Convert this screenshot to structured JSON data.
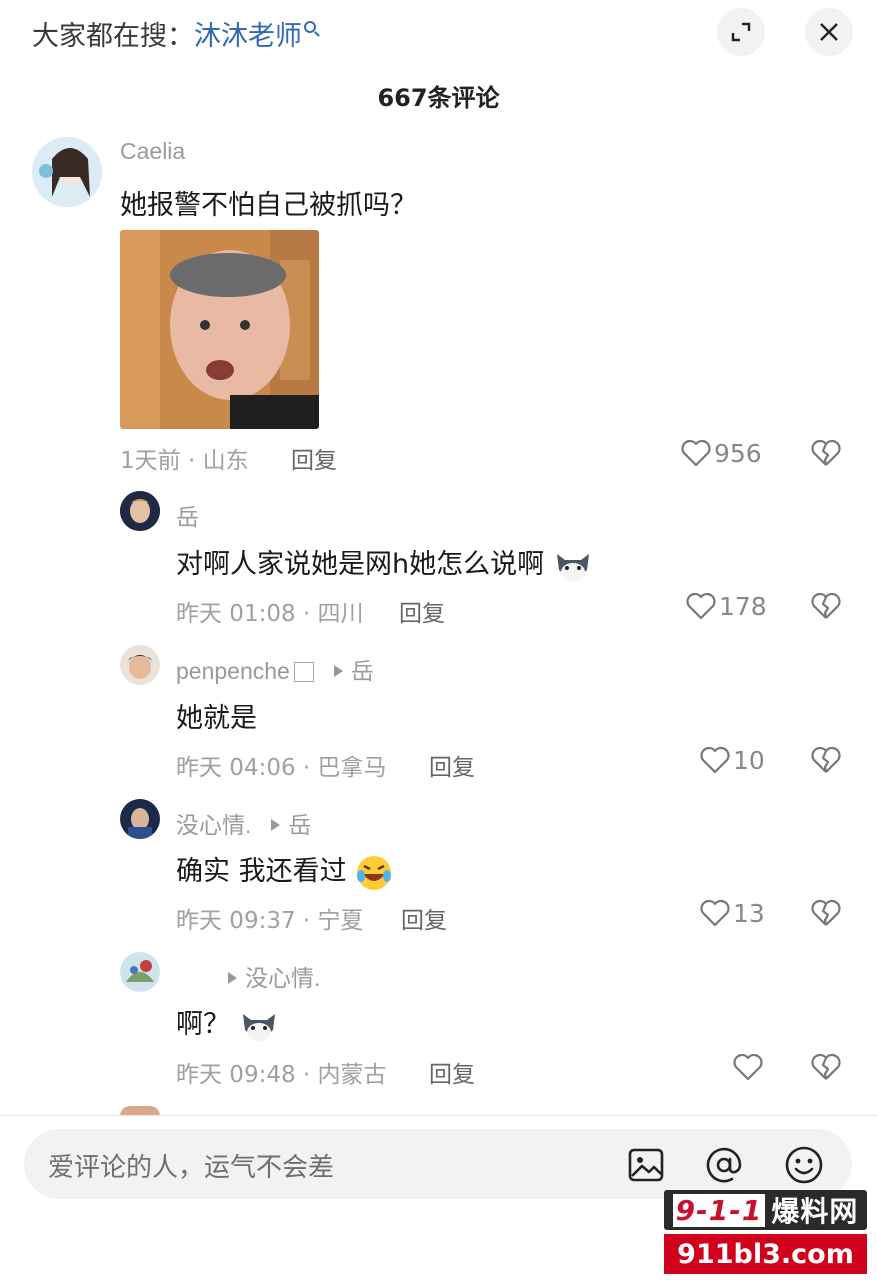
{
  "header": {
    "search_prefix": "大家都在搜：",
    "search_keyword": "沐沐老师",
    "expand_icon": "expand-icon",
    "close_icon": "close-icon",
    "comment_count": "667条评论"
  },
  "comments": [
    {
      "username": "Caelia",
      "text": "她报警不怕自己被抓吗？",
      "meta": "1天前 · 山东",
      "reply": "回复",
      "likes": "956",
      "has_image": true
    },
    {
      "username": "岳",
      "text": "对啊人家说她是网h她怎么说啊",
      "meta": "昨天 01:08 · 四川",
      "reply": "回复",
      "likes": "178"
    },
    {
      "username": "penpenche",
      "reply_to": "岳",
      "text": "她就是",
      "meta": "昨天 04:06 · 巴拿马",
      "reply": "回复",
      "likes": "10"
    },
    {
      "username": "没心情.",
      "reply_to": "岳",
      "text": "确实 我还看过",
      "meta": "昨天 09:37 · 宁夏",
      "reply": "回复",
      "likes": "13"
    },
    {
      "username": "",
      "reply_to": "没心情.",
      "text": "啊？",
      "meta": "昨天 09:48 · 内蒙古",
      "reply": "回复",
      "likes": ""
    }
  ],
  "input": {
    "placeholder": "爱评论的人，运气不会差",
    "icons": [
      "image-icon",
      "at-icon",
      "emoji-icon"
    ]
  },
  "watermark": {
    "top": "9-1-1 爆料网",
    "top_num": "9-1-1",
    "top_text": "爆料网",
    "bottom": "911bl3.com"
  },
  "colors": {
    "keyword": "#2f6bb3",
    "watermark_red": "#d0021b"
  }
}
